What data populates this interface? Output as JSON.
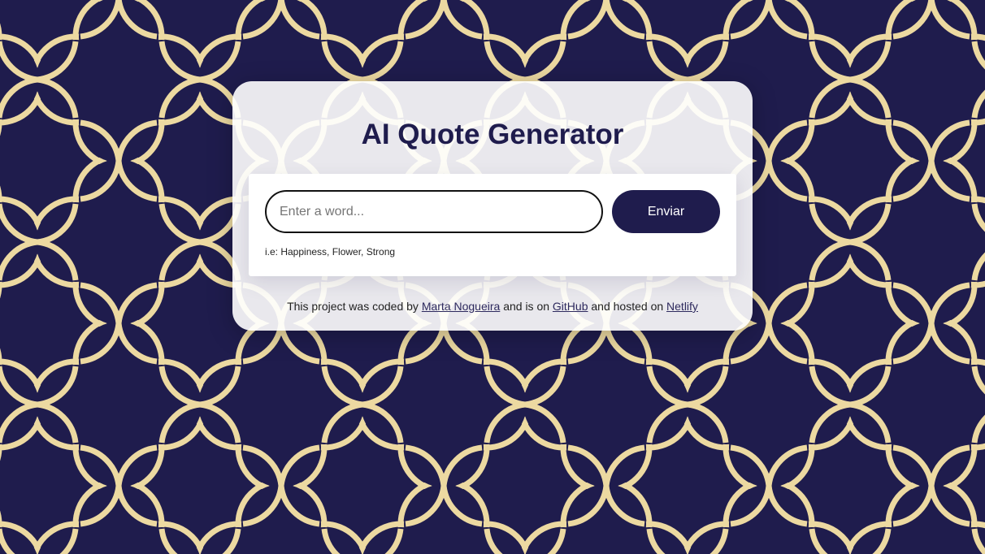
{
  "colors": {
    "background": "#1f1c4d",
    "pattern": "#ecd9a1",
    "accent": "#1f1c4d",
    "card": "#f2f2f5"
  },
  "header": {
    "title": "AI Quote Generator"
  },
  "form": {
    "input_value": "",
    "input_placeholder": "Enter a word...",
    "submit_label": "Enviar",
    "hint": "i.e: Happiness, Flower, Strong"
  },
  "footer": {
    "text_1": "This project was coded by",
    "author_link": "Marta Nogueira",
    "text_2": "and is on",
    "github_link": "GitHub",
    "text_3": "and hosted on",
    "netlify_link": "Netlify"
  }
}
